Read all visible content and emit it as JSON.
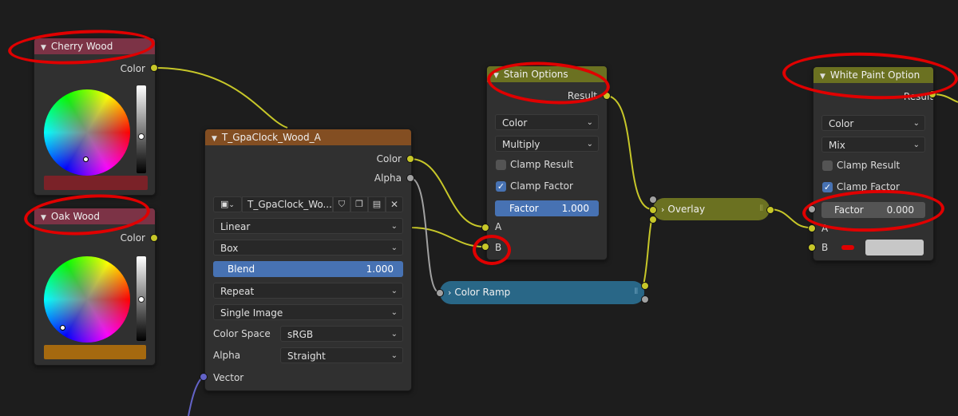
{
  "nodes": {
    "cherry": {
      "title": "Cherry Wood",
      "out_color": "Color",
      "swatch": "#7a2228",
      "header_color": "#7c3346"
    },
    "oak": {
      "title": "Oak Wood",
      "out_color": "Color",
      "swatch": "#a5690f",
      "header_color": "#7c3346"
    },
    "texture": {
      "title": "T_GpaClock_Wood_A",
      "header_color": "#834e22",
      "out_color": "Color",
      "out_alpha": "Alpha",
      "image_name": "T_GpaClock_Wo...",
      "interpolation": "Linear",
      "projection": "Box",
      "blend_label": "Blend",
      "blend_value": "1.000",
      "extension": "Repeat",
      "source": "Single Image",
      "color_space_label": "Color Space",
      "color_space": "sRGB",
      "alpha_label": "Alpha",
      "alpha_mode": "Straight",
      "in_vector": "Vector"
    },
    "stain": {
      "title": "Stain Options",
      "header_color": "#6b7121",
      "out_result": "Result",
      "data_type": "Color",
      "blend_mode": "Multiply",
      "clamp_result": "Clamp Result",
      "clamp_factor": "Clamp Factor",
      "factor_label": "Factor",
      "factor_value": "1.000",
      "in_a": "A",
      "in_b": "B"
    },
    "white": {
      "title": "White Paint Option",
      "header_color": "#6b7121",
      "out_result": "Result",
      "data_type": "Color",
      "blend_mode": "Mix",
      "clamp_result": "Clamp Result",
      "clamp_factor": "Clamp Factor",
      "factor_label": "Factor",
      "factor_value": "0.000",
      "in_a": "A",
      "in_b": "B",
      "b_color": "#c7c7c7"
    },
    "overlay": {
      "title": "Overlay",
      "color": "#6b7121"
    },
    "ramp": {
      "title": "Color Ramp",
      "color": "#296787"
    }
  },
  "colors": {
    "socket_color": "#c7c729",
    "socket_float": "#a1a1a1",
    "socket_vector": "#6363c7",
    "link": "#c7c729",
    "annotation": "#e00000"
  }
}
